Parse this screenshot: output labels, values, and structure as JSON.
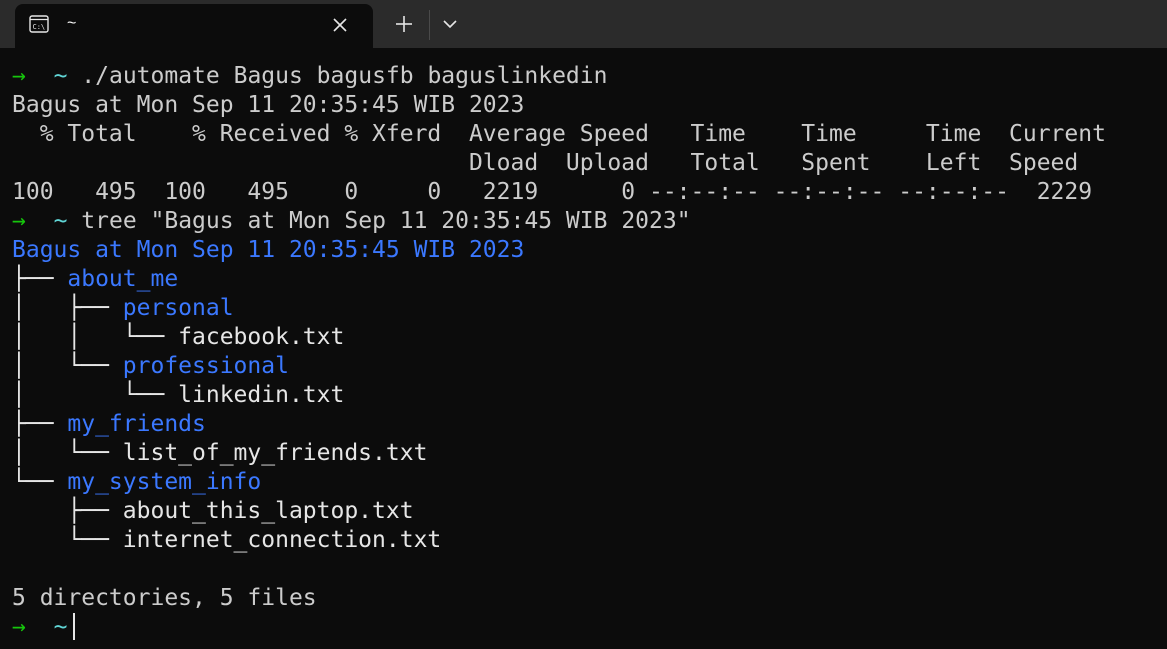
{
  "tab": {
    "title": "~",
    "icon": "terminal-icon"
  },
  "titlebar": {
    "new_tab_icon": "plus-icon",
    "dropdown_icon": "chevron-down-icon",
    "close_icon": "close-icon"
  },
  "colors": {
    "prompt_arrow": "#16c60c",
    "prompt_dir": "#61d6d6",
    "directory": "#3b78ff",
    "text": "#cccccc",
    "background": "#0c0c0c",
    "titlebar": "#2b2b2b"
  },
  "prompt": {
    "arrow": "→",
    "dir": "~"
  },
  "lines": {
    "cmd1": "./automate Bagus bagusfb baguslinkedin",
    "out_date": "Bagus at Mon Sep 11 20:35:45 WIB 2023",
    "curl_header1": "  % Total    % Received % Xferd  Average Speed   Time    Time     Time  Current",
    "curl_header2": "                                 Dload  Upload   Total   Spent    Left  Speed",
    "curl_values": "100   495  100   495    0     0   2219      0 --:--:-- --:--:-- --:--:--  2229",
    "cmd2": "tree \"Bagus at Mon Sep 11 20:35:45 WIB 2023\"",
    "tree_root": "Bagus at Mon Sep 11 20:35:45 WIB 2023",
    "summary": "5 directories, 5 files"
  },
  "tree": [
    {
      "prefix": "├── ",
      "name": "about_me",
      "dir": true
    },
    {
      "prefix": "│   ├── ",
      "name": "personal",
      "dir": true
    },
    {
      "prefix": "│   │   └── ",
      "name": "facebook.txt",
      "dir": false
    },
    {
      "prefix": "│   └── ",
      "name": "professional",
      "dir": true
    },
    {
      "prefix": "│       └── ",
      "name": "linkedin.txt",
      "dir": false
    },
    {
      "prefix": "├── ",
      "name": "my_friends",
      "dir": true
    },
    {
      "prefix": "│   └── ",
      "name": "list_of_my_friends.txt",
      "dir": false
    },
    {
      "prefix": "└── ",
      "name": "my_system_info",
      "dir": true
    },
    {
      "prefix": "    ├── ",
      "name": "about_this_laptop.txt",
      "dir": false
    },
    {
      "prefix": "    └── ",
      "name": "internet_connection.txt",
      "dir": false
    }
  ]
}
